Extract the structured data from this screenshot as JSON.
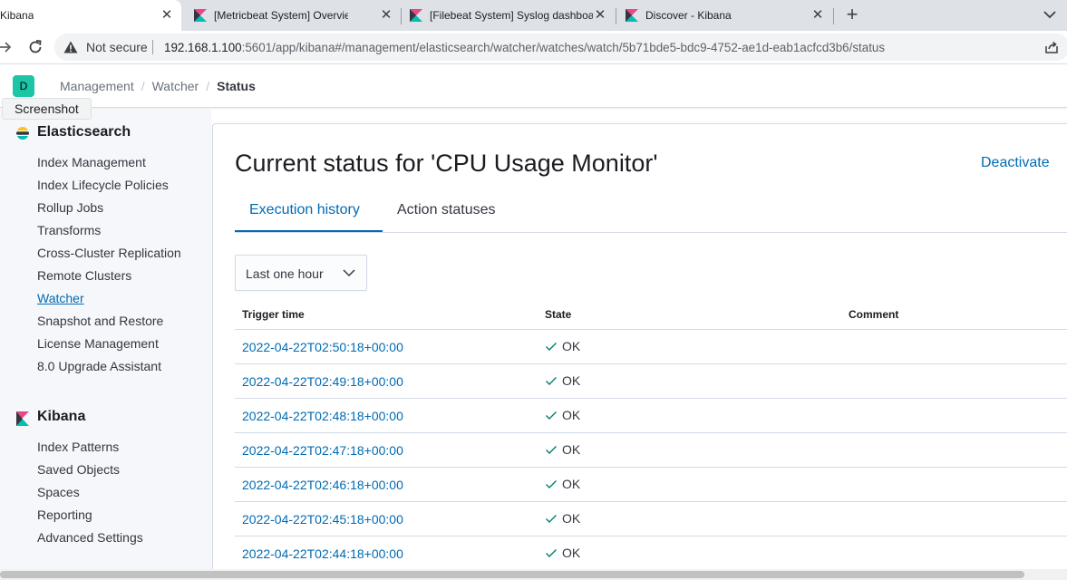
{
  "browser": {
    "tabs": [
      {
        "title": "Kibana",
        "active": true
      },
      {
        "title": "[Metricbeat System] Overview EC",
        "active": false
      },
      {
        "title": "[Filebeat System] Syslog dashboa",
        "active": false
      },
      {
        "title": "Discover - Kibana",
        "active": false
      }
    ],
    "close_glyph": "✕",
    "new_tab_glyph": "+",
    "security_label": "Not secure",
    "url_host": "192.168.1.100",
    "url_rest": ":5601/app/kibana#/management/elasticsearch/watcher/watches/watch/5b71bde5-bdc9-4752-ae1d-eab1acfcd3b6/status",
    "tooltip": "Screenshot"
  },
  "header": {
    "space_initial": "D",
    "breadcrumbs": [
      "Management",
      "Watcher",
      "Status"
    ],
    "breadcrumb_separator": "/"
  },
  "sidebar": {
    "groups": [
      {
        "title": "Elasticsearch",
        "icon": "elasticsearch-logo-icon",
        "items": [
          "Index Management",
          "Index Lifecycle Policies",
          "Rollup Jobs",
          "Transforms",
          "Cross-Cluster Replication",
          "Remote Clusters",
          "Watcher",
          "Snapshot and Restore",
          "License Management",
          "8.0 Upgrade Assistant"
        ],
        "selected": "Watcher"
      },
      {
        "title": "Kibana",
        "icon": "kibana-logo-icon",
        "items": [
          "Index Patterns",
          "Saved Objects",
          "Spaces",
          "Reporting",
          "Advanced Settings"
        ]
      }
    ]
  },
  "main": {
    "title": "Current status for 'CPU Usage Monitor'",
    "deactivate_label": "Deactivate",
    "tabs": [
      {
        "label": "Execution history",
        "selected": true
      },
      {
        "label": "Action statuses",
        "selected": false
      }
    ],
    "range_select": {
      "value": "Last one hour"
    },
    "table": {
      "columns": [
        "Trigger time",
        "State",
        "Comment"
      ],
      "rows": [
        {
          "trigger_time": "2022-04-22T02:50:18+00:00",
          "state": "OK",
          "comment": ""
        },
        {
          "trigger_time": "2022-04-22T02:49:18+00:00",
          "state": "OK",
          "comment": ""
        },
        {
          "trigger_time": "2022-04-22T02:48:18+00:00",
          "state": "OK",
          "comment": ""
        },
        {
          "trigger_time": "2022-04-22T02:47:18+00:00",
          "state": "OK",
          "comment": ""
        },
        {
          "trigger_time": "2022-04-22T02:46:18+00:00",
          "state": "OK",
          "comment": ""
        },
        {
          "trigger_time": "2022-04-22T02:45:18+00:00",
          "state": "OK",
          "comment": ""
        },
        {
          "trigger_time": "2022-04-22T02:44:18+00:00",
          "state": "OK",
          "comment": ""
        }
      ]
    }
  },
  "colors": {
    "link": "#006bb4",
    "ok_check": "#017d73",
    "space_avatar": "#1bc5a6",
    "sidebar_bg": "#f5f7fa"
  }
}
